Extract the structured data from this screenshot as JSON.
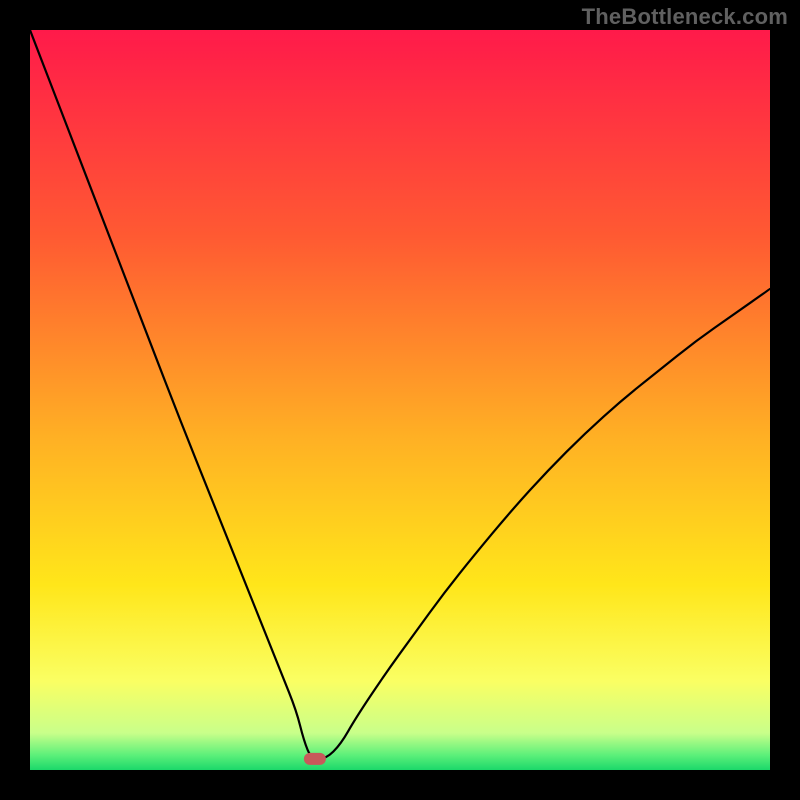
{
  "watermark": "TheBottleneck.com",
  "chart_data": {
    "type": "line",
    "title": "",
    "xlabel": "",
    "ylabel": "",
    "xlim": [
      0,
      100
    ],
    "ylim": [
      0,
      100
    ],
    "x": [
      0,
      5,
      10,
      15,
      20,
      25,
      30,
      32,
      34,
      36,
      37,
      38,
      40,
      42,
      44,
      48,
      52,
      56,
      60,
      65,
      70,
      75,
      80,
      85,
      90,
      95,
      100
    ],
    "values": [
      100,
      87,
      74,
      61,
      48,
      35.5,
      23,
      18,
      13,
      8,
      4,
      1.5,
      1.5,
      3.5,
      7,
      13,
      18.5,
      24,
      29,
      35,
      40.5,
      45.5,
      50,
      54,
      58,
      61.5,
      65
    ],
    "marker": {
      "x": 38.5,
      "y": 1.5,
      "label": ""
    },
    "background_gradient_stops": [
      {
        "pct": 0,
        "color": "#ff1a4a"
      },
      {
        "pct": 28,
        "color": "#ff5a32"
      },
      {
        "pct": 55,
        "color": "#ffb024"
      },
      {
        "pct": 75,
        "color": "#ffe61a"
      },
      {
        "pct": 88,
        "color": "#faff63"
      },
      {
        "pct": 95,
        "color": "#c9ff8a"
      },
      {
        "pct": 98,
        "color": "#5cf07a"
      },
      {
        "pct": 100,
        "color": "#1bd86a"
      }
    ]
  }
}
